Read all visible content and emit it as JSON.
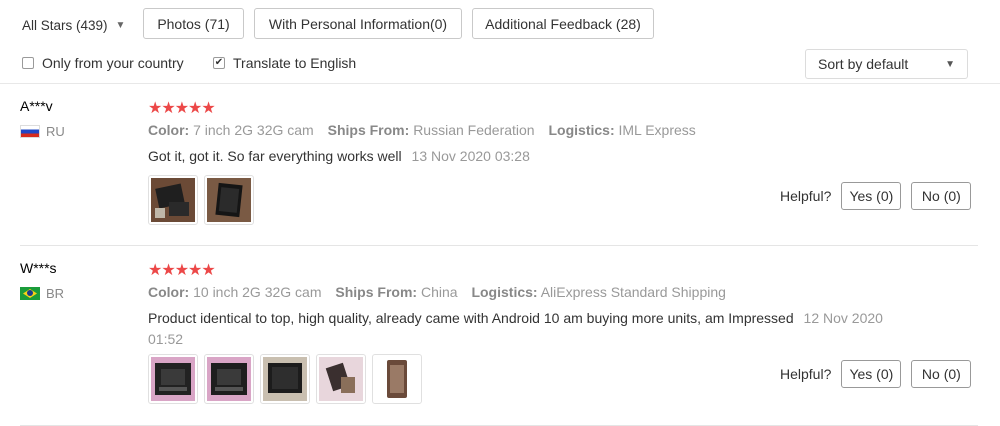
{
  "filters": {
    "all_stars": "All Stars (439)",
    "photos": "Photos (71)",
    "personal_info": "With Personal Information(0)",
    "additional_feedback": "Additional Feedback (28)",
    "only_country": "Only from your country",
    "only_country_checked": false,
    "translate": "Translate to English",
    "translate_checked": true,
    "sort": "Sort by default"
  },
  "labels": {
    "color": "Color:",
    "ships_from": "Ships From:",
    "logistics": "Logistics:",
    "helpful": "Helpful?"
  },
  "colors": {
    "star": "#ec4848",
    "muted": "#999999"
  },
  "reviews": [
    {
      "user": "A***v",
      "country_code": "RU",
      "stars": "★★★★★",
      "color": "7 inch 2G 32G cam",
      "ships_from": "Russian Federation",
      "logistics": "IML Express",
      "text": "Got it, got it. So far everything works well",
      "date": "13 Nov 2020 03:28",
      "yes": "Yes (0)",
      "no": "No (0)",
      "photo_count": 2
    },
    {
      "user": "W***s",
      "country_code": "BR",
      "stars": "★★★★★",
      "color": "10 inch 2G 32G cam",
      "ships_from": "China",
      "logistics": "AliExpress Standard Shipping",
      "text": "Product identical to top, high quality, already came with Android 10 am buying more units, am Impressed",
      "date": "12 Nov 2020 01:52",
      "yes": "Yes (0)",
      "no": "No (0)",
      "photo_count": 5
    }
  ]
}
